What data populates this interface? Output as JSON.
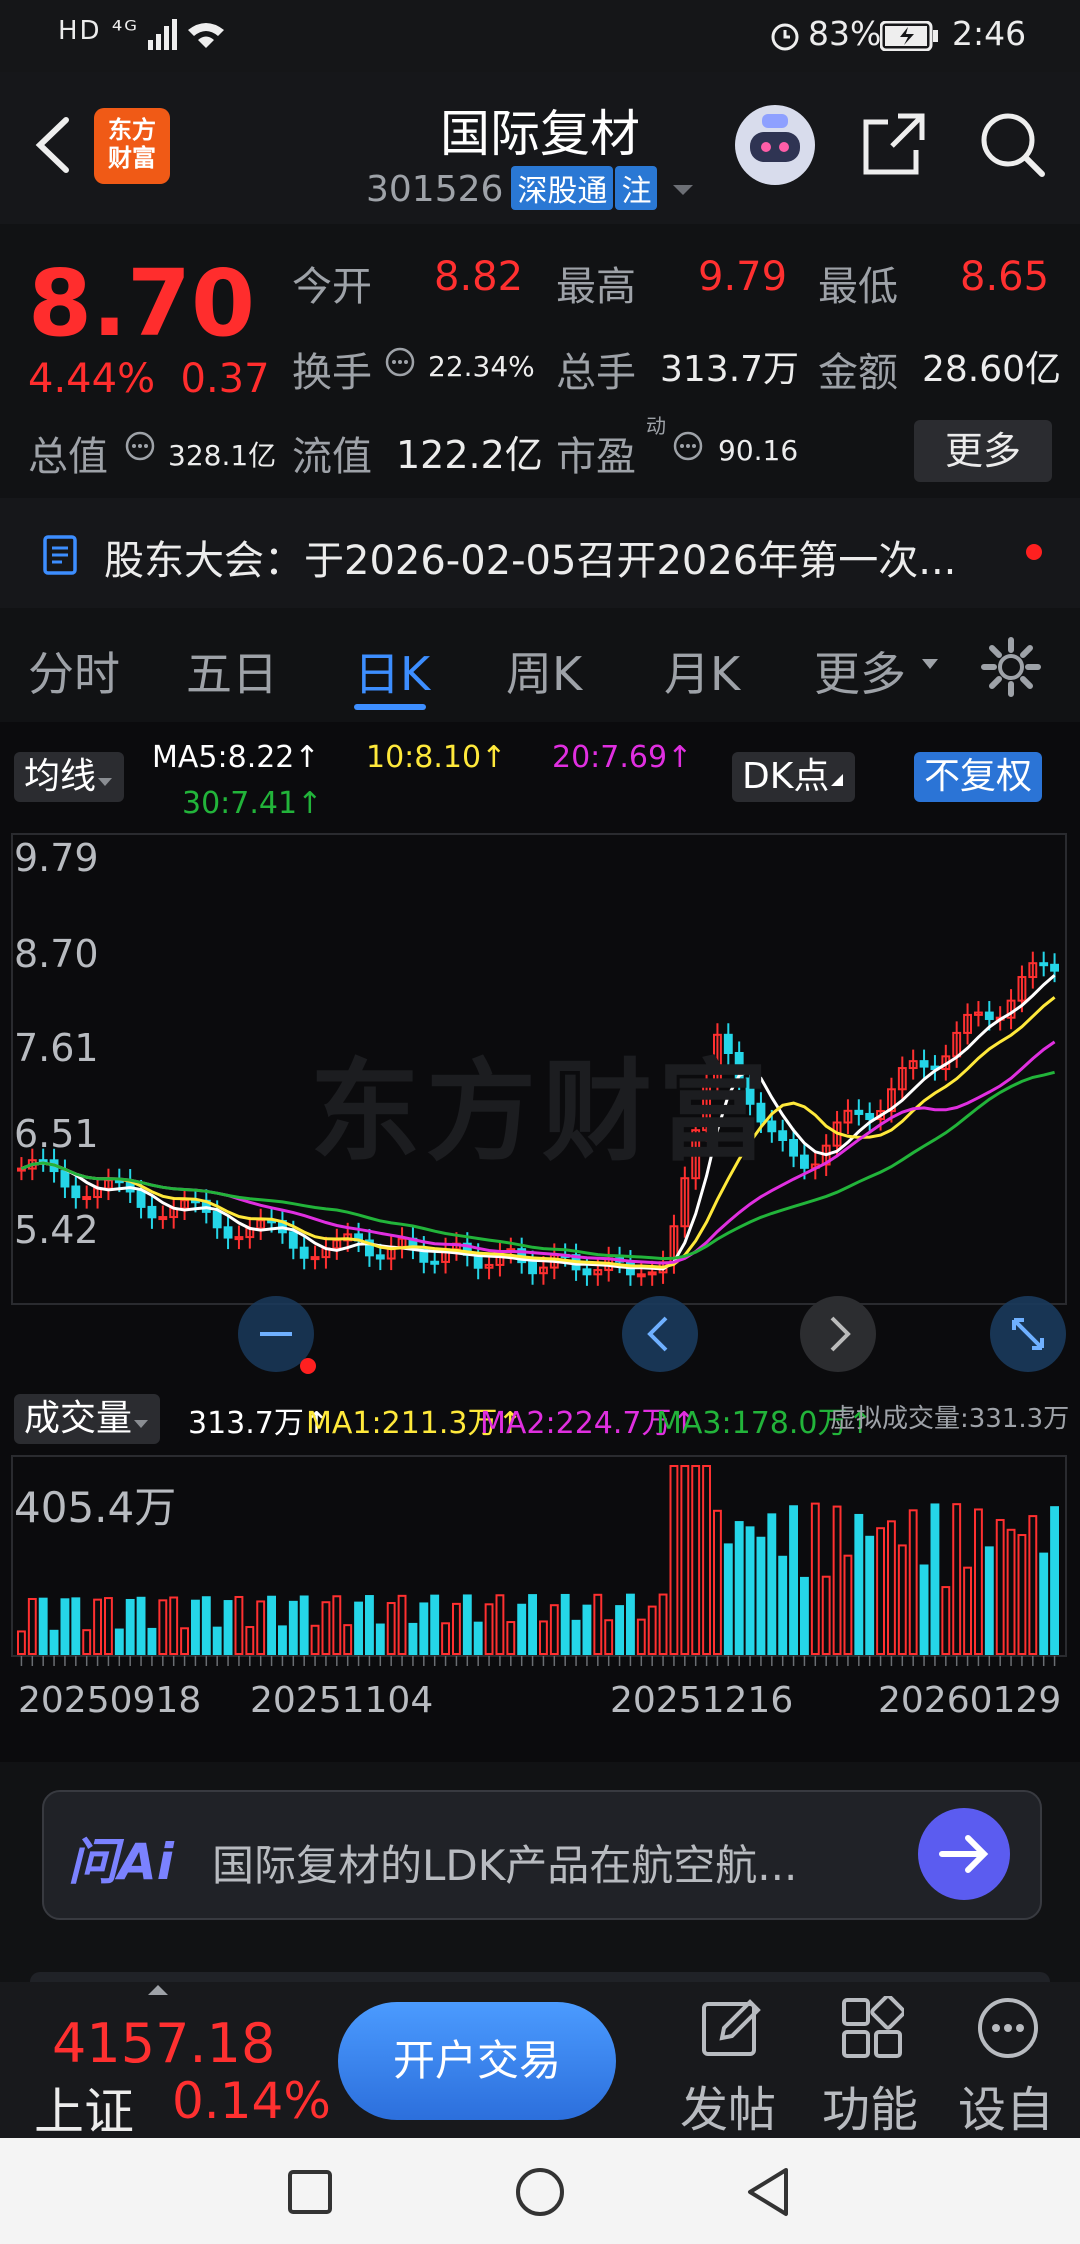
{
  "status": {
    "network": "HD ⁴ᴳ",
    "battery": "83%",
    "time": "2:46"
  },
  "header": {
    "logo": "东方财富",
    "title": "国际复材",
    "code": "301526",
    "tag1": "深股通",
    "tag2": "注"
  },
  "quote": {
    "price": "8.70",
    "pct": "4.44%",
    "change": "0.37",
    "open_label": "今开",
    "open": "8.82",
    "high_label": "最高",
    "high": "9.79",
    "low_label": "最低",
    "low": "8.65",
    "turnover_label": "换手",
    "turnover": "22.34%",
    "volume_label": "总手",
    "volume": "313.7万",
    "amount_label": "金额",
    "amount": "28.60亿",
    "mcap_label": "总值",
    "mcap": "328.1亿",
    "float_label": "流值",
    "float": "122.2亿",
    "pe_label": "市盈",
    "pe_sup": "动",
    "pe": "90.16",
    "more": "更多"
  },
  "notice": {
    "text": "股东大会：于2026-02-05召开2026年第一次..."
  },
  "tabs": [
    "分时",
    "五日",
    "日K",
    "周K",
    "月K",
    "更多"
  ],
  "active_tab": 2,
  "ma": {
    "selector": "均线",
    "ma5": "MA5:8.22↑",
    "ma10": "10:8.10↑",
    "ma20": "20:7.69↑",
    "ma30": "30:7.41↑",
    "dk": "DK点",
    "fq": "不复权"
  },
  "price_axis": [
    "9.79",
    "8.70",
    "7.61",
    "6.51",
    "5.42"
  ],
  "volume": {
    "selector": "成交量",
    "vol": "313.7万↑",
    "ma1": "MA1:211.3万↑",
    "ma2": "MA2:224.7万↑",
    "ma3": "MA3:178.0万↑",
    "virtual": "虚拟成交量:331.3万",
    "max": "405.4万"
  },
  "dates": [
    "20250918",
    "20251104",
    "20251216",
    "20260129"
  ],
  "watermark": "东方财富",
  "ai": {
    "logo": "问Ai",
    "text": "国际复材的LDK产品在航空航..."
  },
  "bottom": {
    "index_value": "4157.18",
    "index_name": "上证",
    "index_pct": "0.14%",
    "trade": "开户交易",
    "post": "发帖",
    "func": "功能",
    "setting": "设自"
  },
  "colors": {
    "up": "#ff3030",
    "down": "#25d6e8",
    "ma5": "#ffffff",
    "ma10": "#ffe93b",
    "ma20": "#e02fe0",
    "ma30": "#22b43a",
    "accent": "#3d8eff"
  }
}
